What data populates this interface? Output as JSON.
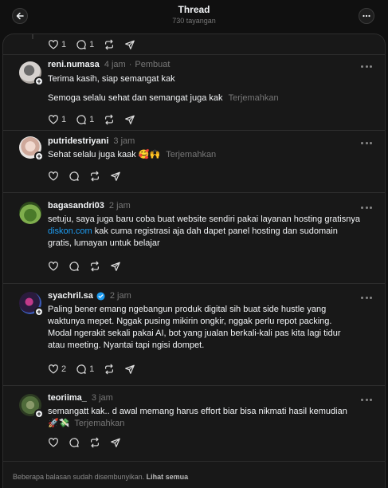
{
  "header": {
    "title": "Thread",
    "views": "730 tayangan"
  },
  "top_actions": {
    "likes": "1",
    "replies": "1"
  },
  "replies": [
    {
      "username": "reni.numasa",
      "time": "4 jam",
      "role": "Pembuat",
      "lines": [
        "Terima kasih, siap semangat kak"
      ],
      "second_text": "Semoga selalu sehat dan semangat juga kak",
      "translate": "Terjemahkan",
      "likes": "1",
      "replies": "1"
    },
    {
      "username": "putridestriyani",
      "time": "3 jam",
      "text": "Sehat selalu juga kaak 🥰🙌",
      "translate": "Terjemahkan"
    },
    {
      "username": "bagasandri03",
      "time": "2 jam",
      "line1": "setuju, saya juga baru coba buat website sendiri pakai layanan hosting gratisnya",
      "link": "diskon.com",
      "line2_rest": " kak cuma registrasi aja dah dapet panel hosting dan sudomain",
      "line3": "gratis, lumayan untuk belajar"
    },
    {
      "username": "syachril.sa",
      "time": "2 jam",
      "lines": [
        "Paling bener emang ngebangun produk digital sih buat side hustle yang",
        "waktunya mepet. Nggak pusing mikirin ongkir, nggak perlu repot packing.",
        "Modal ngerakit sekali pakai AI, bot yang jualan berkali-kali pas kita lagi tidur",
        "atau meeting. Nyantai tapi ngisi dompet."
      ],
      "likes": "2",
      "replies": "1"
    },
    {
      "username": "teoriima_",
      "time": "3 jam",
      "line1": "semangatt kak.. d awal memang harus effort biar bisa nikmati hasil kemudian",
      "emoji": "🚀💸",
      "translate": "Terjemahkan"
    }
  ],
  "footer": {
    "text": "Beberapa balasan sudah disembunyikan.",
    "link": "Lihat semua"
  },
  "colors": {
    "background": "#101010",
    "panel": "#181818",
    "link": "#1d9bf0",
    "verified": "#1d9bf0"
  }
}
